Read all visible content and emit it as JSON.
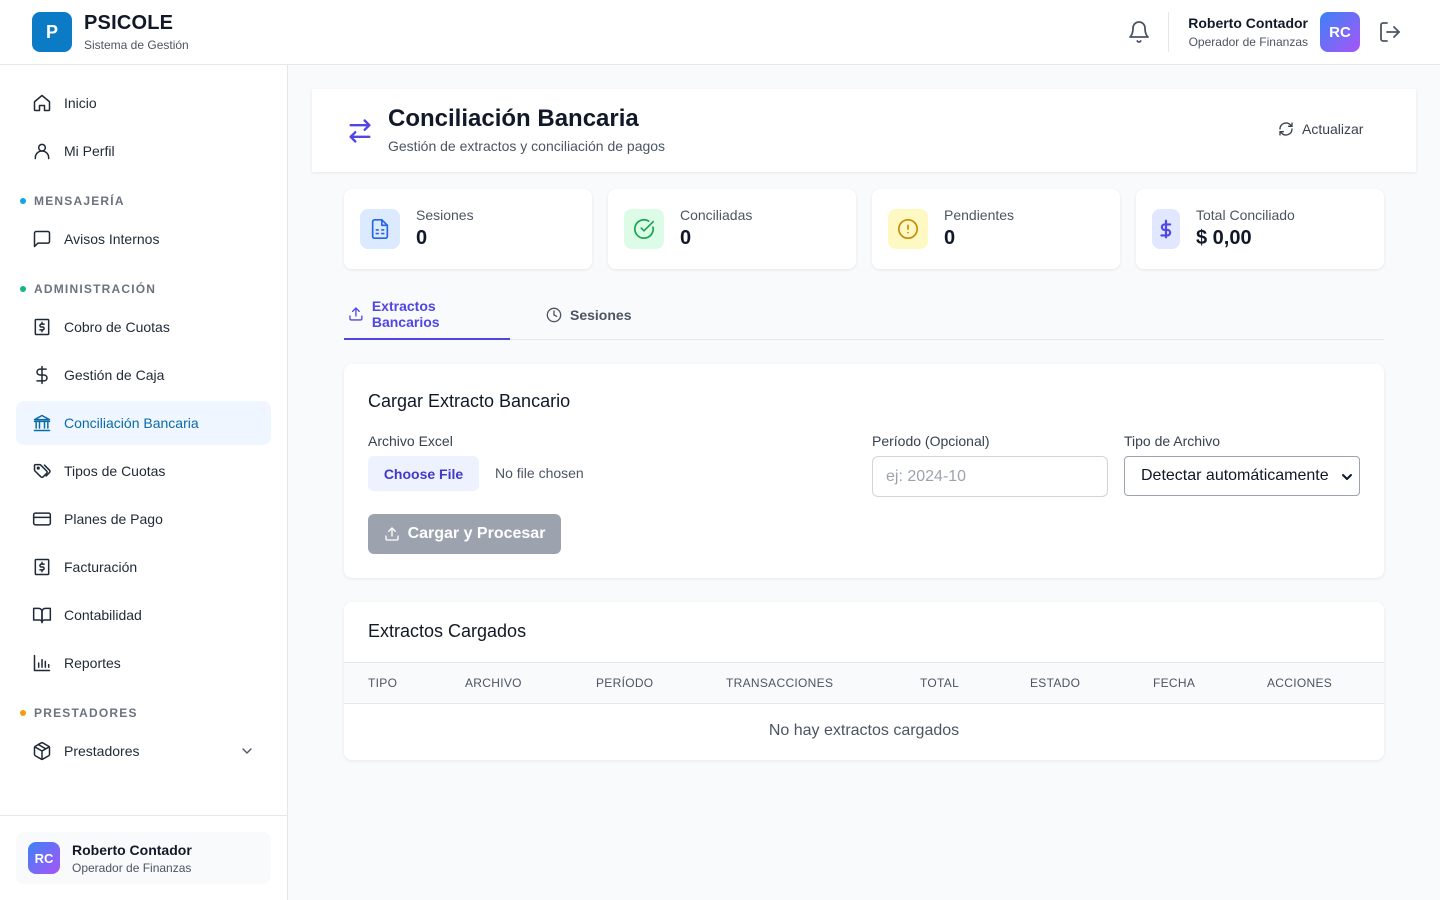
{
  "header": {
    "logo_letter": "P",
    "brand": "PSICOLE",
    "subtitle": "Sistema de Gestión",
    "user_name": "Roberto Contador",
    "user_role": "Operador de Finanzas",
    "avatar_initials": "RC"
  },
  "sidebar": {
    "items": [
      {
        "label": "Inicio",
        "icon": "home-icon"
      },
      {
        "label": "Mi Perfil",
        "icon": "user-icon"
      },
      {
        "label": "Avisos Internos",
        "icon": "message-icon"
      },
      {
        "label": "Cobro de Cuotas",
        "icon": "receipt-icon"
      },
      {
        "label": "Gestión de Caja",
        "icon": "dollar-icon"
      },
      {
        "label": "Conciliación Bancaria",
        "icon": "bank-icon",
        "active": true
      },
      {
        "label": "Tipos de Cuotas",
        "icon": "tags-icon"
      },
      {
        "label": "Planes de Pago",
        "icon": "credit-card-icon"
      },
      {
        "label": "Facturación",
        "icon": "invoice-icon"
      },
      {
        "label": "Contabilidad",
        "icon": "book-icon"
      },
      {
        "label": "Reportes",
        "icon": "bar-chart-icon"
      },
      {
        "label": "Prestadores",
        "icon": "package-icon"
      }
    ],
    "sections": [
      {
        "label": "MENSAJERÍA",
        "color": "#0ea5e9"
      },
      {
        "label": "ADMINISTRACIÓN",
        "color": "#10b981"
      },
      {
        "label": "PRESTADORES",
        "color": "#f59e0b"
      }
    ],
    "footer": {
      "initials": "RC",
      "name": "Roberto Contador",
      "role": "Operador de Finanzas"
    }
  },
  "page": {
    "title": "Conciliación Bancaria",
    "subtitle": "Gestión de extractos y conciliación de pagos",
    "refresh_label": "Actualizar"
  },
  "stats": [
    {
      "label": "Sesiones",
      "value": "0",
      "icon": "document-icon",
      "bg": "#dbeafe",
      "fg": "#2563eb"
    },
    {
      "label": "Conciliadas",
      "value": "0",
      "icon": "check-circle-icon",
      "bg": "#dcfce7",
      "fg": "#16a34a"
    },
    {
      "label": "Pendientes",
      "value": "0",
      "icon": "alert-circle-icon",
      "bg": "#fef9c3",
      "fg": "#ca8a04"
    },
    {
      "label": "Total Conciliado",
      "value": "$ 0,00",
      "icon": "dollar-sign-icon",
      "bg": "#e0e7ff",
      "fg": "#4f46e5"
    }
  ],
  "tabs": [
    {
      "label": "Extractos Bancarios",
      "active": true
    },
    {
      "label": "Sesiones",
      "active": false
    }
  ],
  "upload": {
    "title": "Cargar Extracto Bancario",
    "file_label": "Archivo Excel",
    "file_button": "Choose File",
    "file_status": "No file chosen",
    "period_label": "Período (Opcional)",
    "period_placeholder": "ej: 2024-10",
    "type_label": "Tipo de Archivo",
    "type_selected": "Detectar automáticamente",
    "submit_label": "Cargar y Procesar"
  },
  "table": {
    "title": "Extractos Cargados",
    "columns": [
      "TIPO",
      "ARCHIVO",
      "PERÍODO",
      "TRANSACCIONES",
      "TOTAL",
      "ESTADO",
      "FECHA",
      "ACCIONES"
    ],
    "empty_message": "No hay extractos cargados"
  },
  "colors": {
    "accent": "#4f46e5",
    "brand": "#0b7bc5",
    "active_nav_bg": "#eff6ff",
    "active_nav_text": "#0b6aa8"
  }
}
